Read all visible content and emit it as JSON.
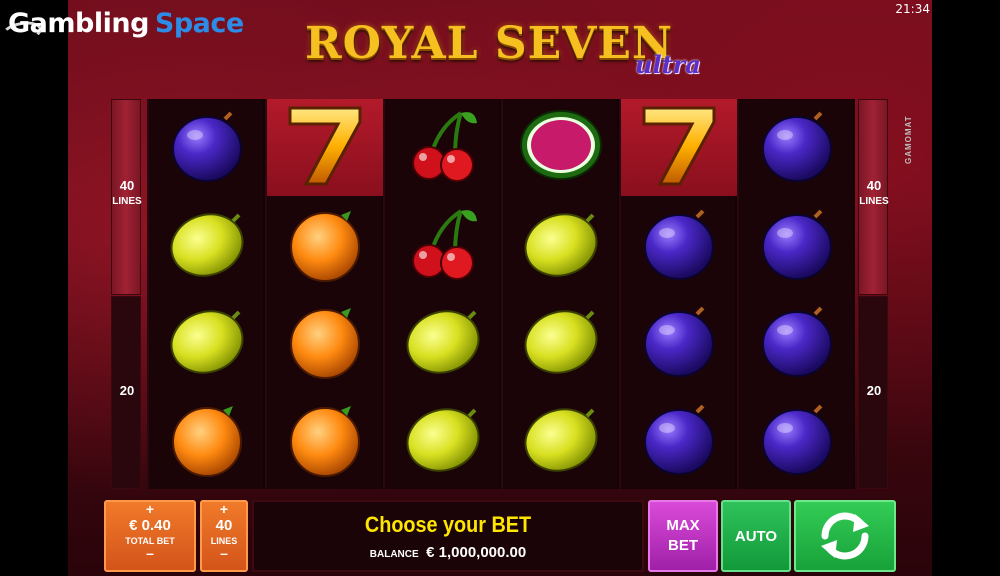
{
  "brand": {
    "word1": "Gambling",
    "word2": "Space"
  },
  "clock": "21:34",
  "logo": {
    "title": "ROYAL SEVEN",
    "suffix": "ultra"
  },
  "provider": "GAMOMAT",
  "lines_indicator": {
    "top_value": "40",
    "top_label": "LINES",
    "bottom_value": "20"
  },
  "reels": [
    [
      "plum",
      "lemon",
      "lemon",
      "orange"
    ],
    [
      "seven",
      "orange",
      "orange",
      "orange"
    ],
    [
      "cherry",
      "cherry",
      "lemon",
      "lemon"
    ],
    [
      "watermelon",
      "lemon",
      "lemon",
      "lemon"
    ],
    [
      "seven",
      "plum",
      "plum",
      "plum"
    ],
    [
      "plum",
      "plum",
      "plum",
      "plum"
    ]
  ],
  "highlighted": [
    [
      1,
      0
    ],
    [
      4,
      0
    ]
  ],
  "controls": {
    "total_bet": {
      "plus": "+",
      "value": "€ 0.40",
      "label": "TOTAL BET",
      "minus": "–"
    },
    "lines": {
      "plus": "+",
      "value": "40",
      "label": "LINES",
      "minus": "–"
    },
    "message": "Choose your BET",
    "balance_label": "BALANCE",
    "balance_value": "€ 1,000,000.00",
    "max_bet_line1": "MAX",
    "max_bet_line2": "BET",
    "auto": "AUTO",
    "spin_icon": "spin-arrows-icon"
  },
  "colors": {
    "accent_gold": "#f5c020",
    "message_yellow": "#ffe600",
    "spin_green": "#33cc55",
    "max_bet_magenta": "#d94ad9",
    "bet_orange": "#f07a2a"
  }
}
